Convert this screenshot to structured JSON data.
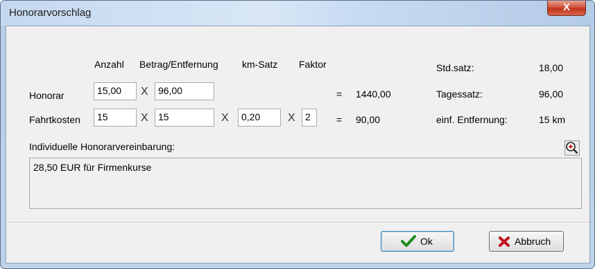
{
  "window": {
    "title": "Honorarvorschlag",
    "close_glyph": "X"
  },
  "columns": {
    "anzahl": "Anzahl",
    "betrag": "Betrag/Entfernung",
    "km_satz": "km-Satz",
    "faktor": "Faktor"
  },
  "honorar": {
    "label": "Honorar",
    "anzahl": "15,00",
    "times": "X",
    "betrag": "96,00",
    "equals": "=",
    "result": "1440,00"
  },
  "fahrtkosten": {
    "label": "Fahrtkosten",
    "anzahl": "15",
    "times": "X",
    "betrag": "15",
    "km_satz": "0,20",
    "faktor": "2",
    "equals": "=",
    "result": "90,00"
  },
  "rates": {
    "std_label": "Std.satz:",
    "std_value": "18,00",
    "tag_label": "Tagessatz:",
    "tag_value": "96,00",
    "entf_label": "einf. Entfernung:",
    "entf_value": "15 km"
  },
  "individuell": {
    "label": "Individuelle Honorarvereinbarung:",
    "text": "28,50 EUR für Firmenkurse"
  },
  "buttons": {
    "ok": "Ok",
    "abbruch": "Abbruch"
  },
  "icons": {
    "zoom": "zoom-in-icon",
    "ok": "checkmark-icon",
    "abbruch": "red-x-icon"
  }
}
